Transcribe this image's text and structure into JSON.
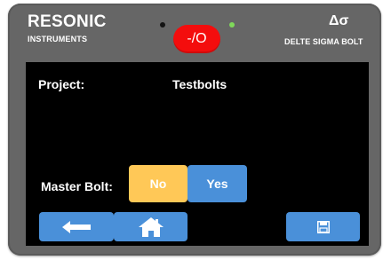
{
  "header": {
    "brand": "RESONIC",
    "brand_sub": "INSTRUMENTS",
    "power_label": "-/O",
    "model_symbol": "Δσ",
    "model_name": "DELTE SIGMA BOLT"
  },
  "screen": {
    "project_label": "Project:",
    "project_value": "Testbolts",
    "master_label": "Master Bolt:",
    "options": [
      {
        "label": "No",
        "selected": true
      },
      {
        "label": "Yes",
        "selected": false
      }
    ]
  },
  "nav": {
    "back_icon": "arrow-left-icon",
    "home_icon": "home-icon",
    "save_icon": "save-icon"
  },
  "colors": {
    "bezel": "#666666",
    "screen": "#000000",
    "power": "#f40d0d",
    "led_active": "#7fd95a",
    "button_blue": "#4a90d9",
    "selected_yellow": "#ffc857"
  }
}
